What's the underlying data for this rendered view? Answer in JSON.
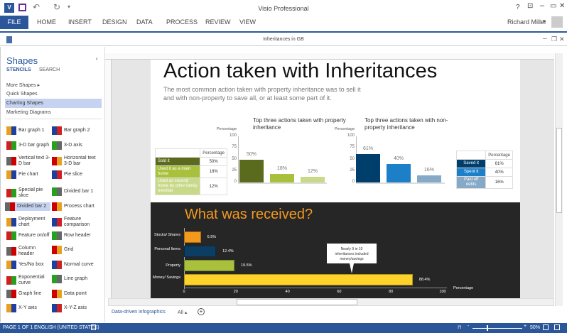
{
  "window": {
    "title": "Visio Professional",
    "user": "Richard Miller",
    "help": "?"
  },
  "ribbon": {
    "file": "FILE",
    "tabs": [
      "HOME",
      "INSERT",
      "DESIGN",
      "DATA",
      "PROCESS",
      "REVIEW",
      "VIEW"
    ]
  },
  "document": {
    "title": "Inheritances in GB"
  },
  "shapes": {
    "title": "Shapes",
    "stencils_tab": "STENCILS",
    "search_tab": "SEARCH",
    "stencils": [
      "More Shapes",
      "Quick Shapes",
      "Charting Shapes",
      "Marketing Diagrams"
    ],
    "items": [
      "Bar graph 1",
      "Bar graph 2",
      "3-D bar graph",
      "3-D axis",
      "Vertical text 3-D bar",
      "Horizontal text 3-D bar",
      "Pie chart",
      "Pie slice",
      "Special pie slice",
      "Divided bar 1",
      "Divided bar 2",
      "Process chart",
      "Deployment chart",
      "Feature comparison",
      "Feature on/off",
      "Row header",
      "Column header",
      "Grid",
      "Yes/No box",
      "Normal curve",
      "Exponential curve",
      "Line graph",
      "Graph line",
      "Data point",
      "X-Y axis",
      "X-Y-Z axis"
    ]
  },
  "page": {
    "heading": "Action taken with Inheritances",
    "subtitle_1": "The most common action taken with property inheritance was to sell it",
    "subtitle_2": "and with non-property to save all, or at least some part of it.",
    "section2_title": "What was received?"
  },
  "chart_data": [
    {
      "type": "bar",
      "title": "Top three actions taken with property inheritance",
      "ylabel": "Percentage",
      "ylim": [
        0,
        100
      ],
      "yticks": [
        "100",
        "75",
        "50",
        "25",
        "0"
      ],
      "categories": [
        "Sold it",
        "Used it as a main home",
        "Used as second home by other family member"
      ],
      "values": [
        50,
        18,
        12
      ],
      "labels": [
        "50%",
        "18%",
        "12%"
      ],
      "colors": [
        "#5a6b1e",
        "#a8c03c",
        "#c8d98a"
      ],
      "table_header": "Percentage"
    },
    {
      "type": "bar",
      "title": "Top three actions taken with non-property inheritance",
      "ylabel": "Percentage",
      "ylim": [
        0,
        100
      ],
      "yticks": [
        "100",
        "75",
        "50",
        "25",
        "0"
      ],
      "categories": [
        "Saved it",
        "Spent it",
        "Paid off debts"
      ],
      "values": [
        61,
        40,
        16
      ],
      "labels": [
        "61%",
        "40%",
        "16%"
      ],
      "colors": [
        "#003e6b",
        "#1e7fc9",
        "#86a9c8"
      ],
      "table_header": "Percentage"
    },
    {
      "type": "bar",
      "orientation": "horizontal",
      "title": "What was received?",
      "xlabel": "Percentage",
      "xlim": [
        0,
        100
      ],
      "xticks": [
        "0",
        "20",
        "40",
        "60",
        "80",
        "100"
      ],
      "categories": [
        "Stocks/ Shares",
        "Personal Items",
        "Property",
        "Money/ Savings"
      ],
      "values": [
        6.5,
        12.4,
        19.5,
        88.4
      ],
      "labels": [
        "6.5%",
        "12.4%",
        "19.5%",
        "88.4%"
      ],
      "colors": [
        "#f39a1e",
        "#0c3e63",
        "#a8c03c",
        "#fdd22a"
      ],
      "callout": "Nearly 9 in 10 inheritances included money/savings"
    }
  ],
  "pages_bar": {
    "page_tab": "Data-driven infographics",
    "all": "All ▴",
    "add": "+"
  },
  "status": {
    "page": "PAGE 1 OF 1",
    "language": "ENGLISH (UNITED STATES)",
    "zoom": "50%"
  }
}
